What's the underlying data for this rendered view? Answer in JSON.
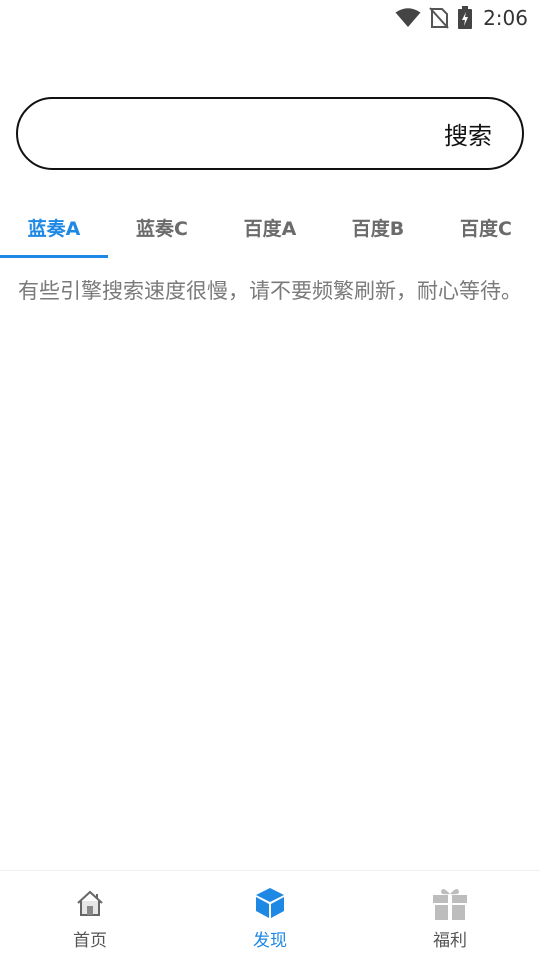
{
  "status_bar": {
    "time": "2:06",
    "icons": [
      "wifi-icon",
      "no-sim-icon",
      "battery-charging-icon"
    ]
  },
  "search": {
    "placeholder": "",
    "value": "",
    "button_label": "搜索"
  },
  "tabs": [
    {
      "label": "蓝奏A",
      "active": true
    },
    {
      "label": "蓝奏C",
      "active": false
    },
    {
      "label": "百度A",
      "active": false
    },
    {
      "label": "百度B",
      "active": false
    },
    {
      "label": "百度C",
      "active": false
    }
  ],
  "notice": "有些引擎搜索速度很慢，请不要频繁刷新，耐心等待。",
  "bottom_nav": [
    {
      "label": "首页",
      "icon": "home-icon",
      "active": false
    },
    {
      "label": "发现",
      "icon": "cube-icon",
      "active": true
    },
    {
      "label": "福利",
      "icon": "gift-icon",
      "active": false
    }
  ],
  "colors": {
    "accent": "#1e88e5",
    "inactive_text": "#6b6b6b",
    "notice_text": "#7a7a7a"
  }
}
